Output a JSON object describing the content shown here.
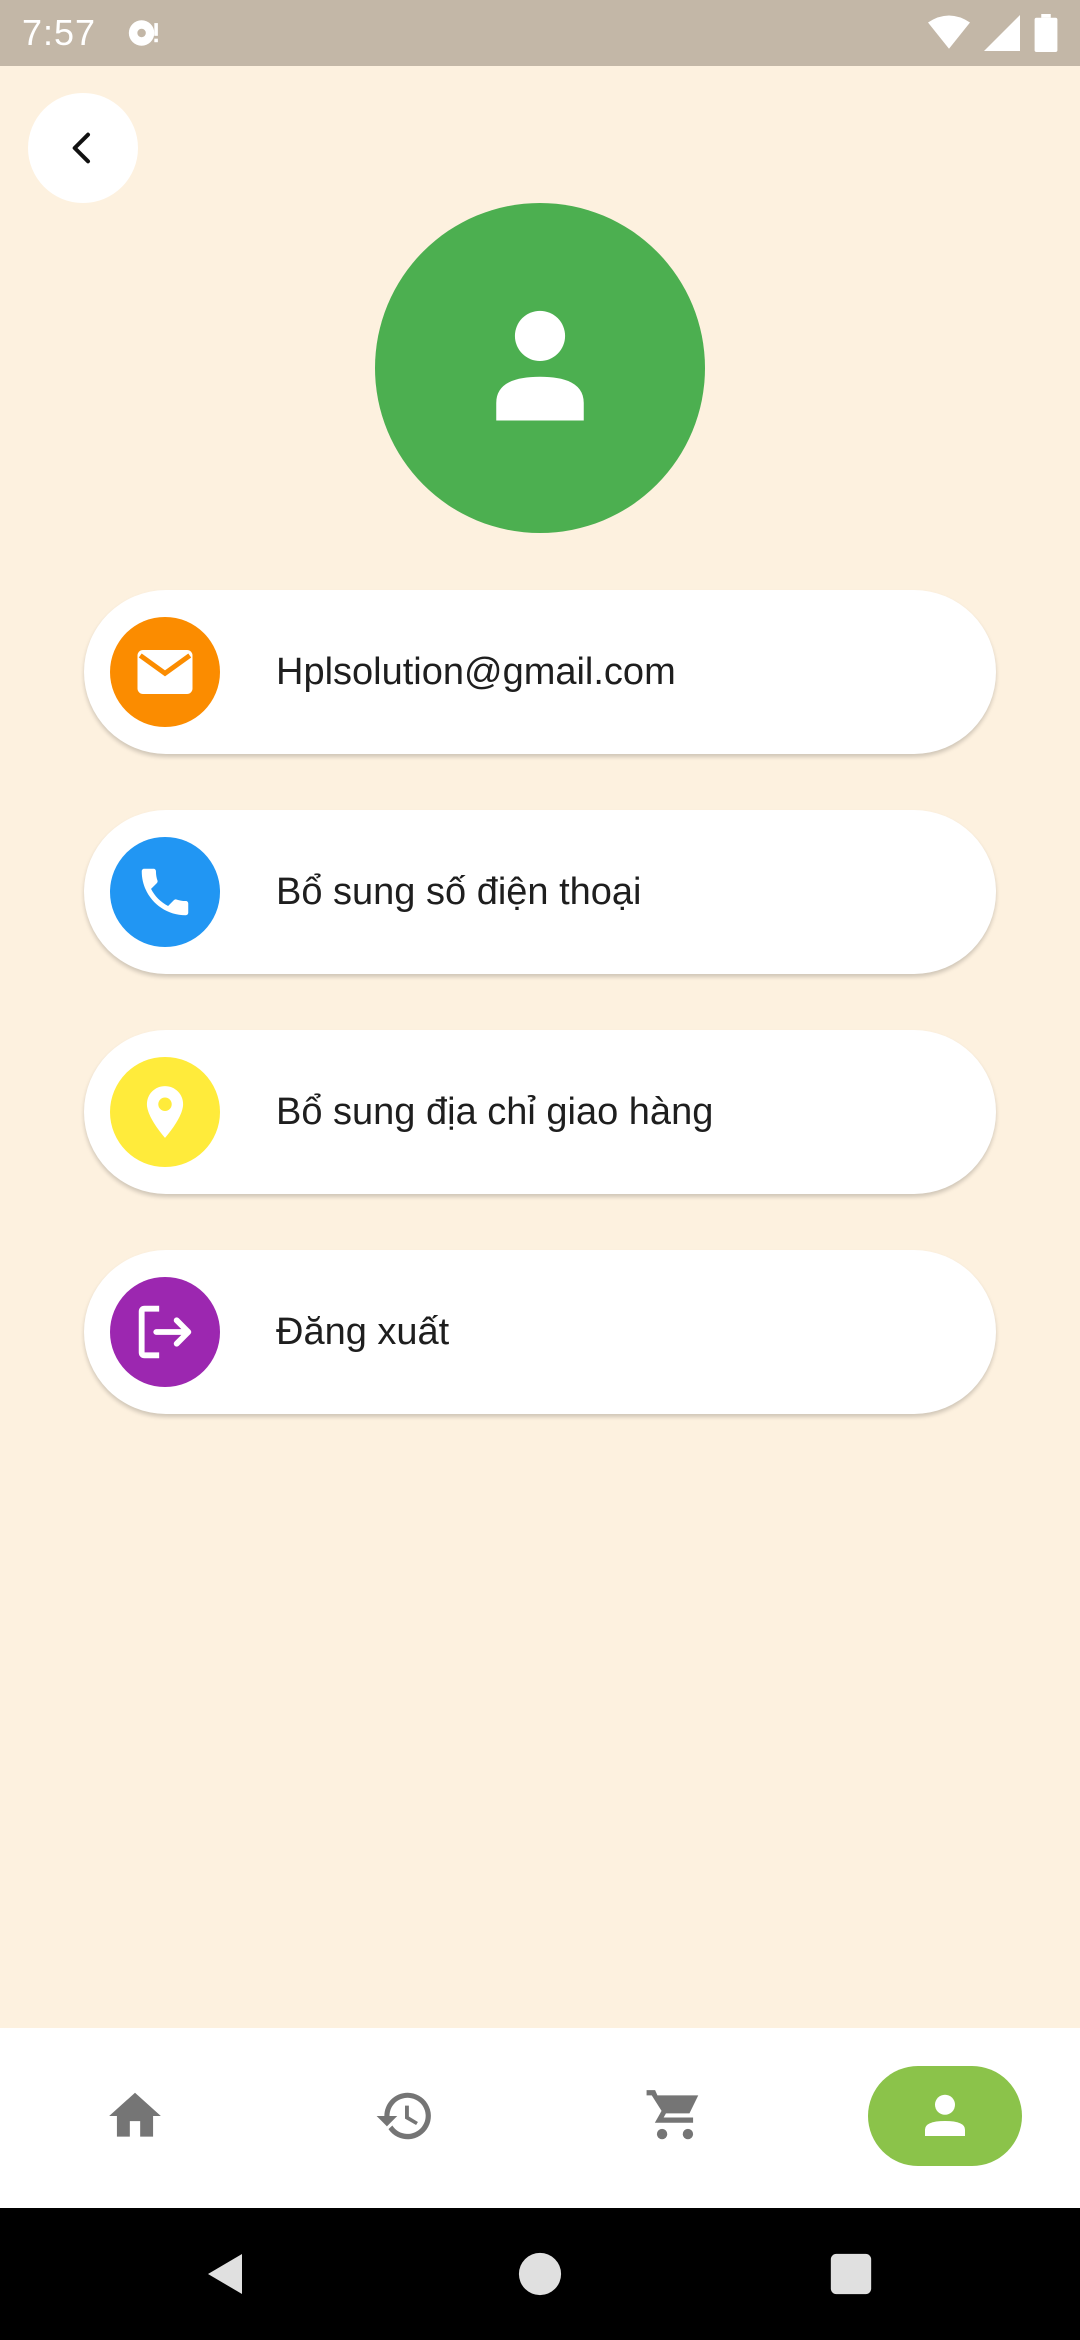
{
  "status_bar": {
    "time": "7:57",
    "icons": [
      "notification-icon",
      "wifi-icon",
      "signal-icon",
      "battery-icon"
    ]
  },
  "header": {
    "back_icon": "chevron-left-icon"
  },
  "profile": {
    "avatar_icon": "person-icon",
    "avatar_color": "#4caf50"
  },
  "menu": {
    "items": [
      {
        "label": "Hplsolution@gmail.com",
        "icon": "mail-icon",
        "color": "#fb8c00"
      },
      {
        "label": "Bổ sung số điện thoại",
        "icon": "phone-icon",
        "color": "#2196f3"
      },
      {
        "label": "Bổ sung địa chỉ giao hàng",
        "icon": "location-pin-icon",
        "color": "#ffeb3b"
      },
      {
        "label": "Đăng xuất",
        "icon": "logout-icon",
        "color": "#9c27b0"
      }
    ]
  },
  "bottom_nav": {
    "items": [
      {
        "icon": "home-icon",
        "active": false
      },
      {
        "icon": "history-icon",
        "active": false
      },
      {
        "icon": "cart-icon",
        "active": false
      },
      {
        "icon": "person-icon",
        "active": true
      }
    ],
    "active_color": "#8bc34a"
  },
  "system_nav": {
    "items": [
      "back-triangle-icon",
      "home-circle-icon",
      "recents-square-icon"
    ]
  }
}
